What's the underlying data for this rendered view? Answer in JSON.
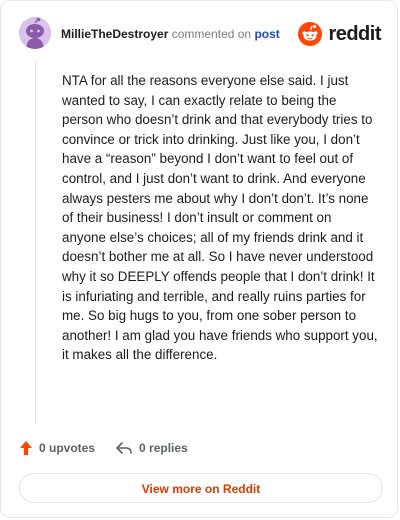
{
  "header": {
    "username": "MillieTheDestroyer",
    "action_text": "commented on",
    "post_link": "post",
    "brand": "reddit",
    "avatar_icon": "snoo-avatar-icon",
    "brand_icon": "reddit-logo-icon"
  },
  "comment": {
    "body": "NTA for all the reasons everyone else said. I just wanted to say, I can exactly relate to being the person who doesn’t drink and that everybody tries to convince or trick into drinking. Just like you, I don’t have a “reason” beyond I don’t want to feel out of control, and I just don’t want to drink. And everyone always pesters me about why I don’t don’t. It’s none of their business! I don’t insult or comment on anyone else’s choices; all of my friends drink and it doesn’t bother me at all. So I have never understood why it so DEEPLY offends people that I don’t drink! It is infuriating and terrible, and really ruins parties for me. So big hugs to you, from one sober person to another! I am glad you have friends who support you, it makes all the difference."
  },
  "actions": {
    "upvotes": "0 upvotes",
    "replies": "0 replies",
    "upvote_icon": "upvote-arrow-icon",
    "reply_icon": "reply-arrow-icon"
  },
  "footer": {
    "view_more": "View more on Reddit"
  },
  "colors": {
    "brand_orange": "#ff4500",
    "link_blue": "#1c4cb0",
    "button_text": "#d93a00",
    "avatar_bg": "#d9c2ec"
  }
}
